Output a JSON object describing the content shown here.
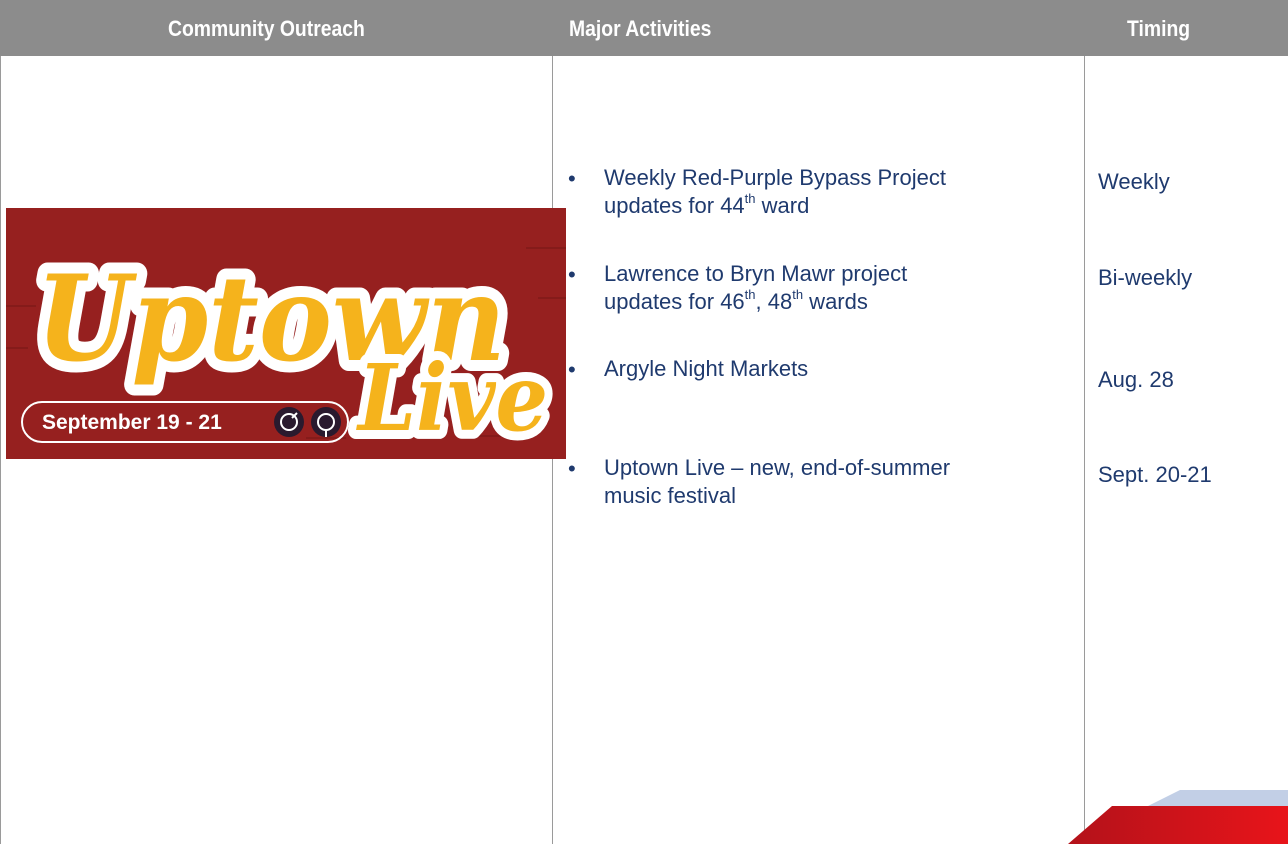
{
  "table": {
    "headers": [
      "Community Outreach",
      "Major Activities",
      "Timing"
    ],
    "rows": [
      {
        "activity": [
          "Weekly Red-Purple Bypass Project",
          "updates for 44",
          "th",
          " ward"
        ],
        "timing": "Weekly"
      },
      {
        "activity": [
          "Lawrence to Bryn Mawr project",
          "updates for 46",
          "th",
          ", 48",
          "th",
          " wards"
        ],
        "timing": "Bi-weekly"
      },
      {
        "activity": [
          "Argyle Night Markets"
        ],
        "timing": "Aug. 28"
      },
      {
        "activity": [
          "Uptown Live – new, end-of-summer",
          "music festival"
        ],
        "timing": "Sept. 20-21"
      }
    ]
  },
  "banner": {
    "logo_word_1": "Uptown",
    "logo_word_2": "Live",
    "dates": "September 19 - 21",
    "colors": {
      "background": "#96201f",
      "lettering": "#f5b31c",
      "outline": "#ffffff",
      "knob": "#2a1a2e"
    }
  },
  "colors": {
    "header_bg": "#8c8c8c",
    "text": "#1f3a6e",
    "accent_red": "#d8141a",
    "accent_blue": "#c2cfe6"
  }
}
